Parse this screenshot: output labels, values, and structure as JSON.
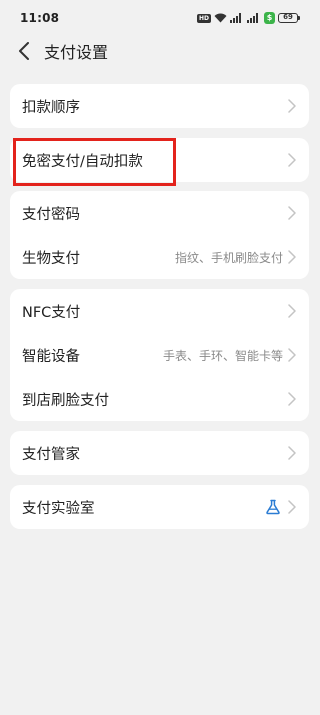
{
  "status_bar": {
    "time": "11:08",
    "hd_label": "HD",
    "battery_level": "69"
  },
  "header": {
    "title": "支付设置"
  },
  "sections": {
    "s1": {
      "r1": {
        "label": "扣款顺序"
      }
    },
    "s2": {
      "r1": {
        "label": "免密支付/自动扣款"
      }
    },
    "s3": {
      "r1": {
        "label": "支付密码"
      },
      "r2": {
        "label": "生物支付",
        "sub": "指纹、手机刷脸支付"
      }
    },
    "s4": {
      "r1": {
        "label": "NFC支付"
      },
      "r2": {
        "label": "智能设备",
        "sub": "手表、手环、智能卡等"
      },
      "r3": {
        "label": "到店刷脸支付"
      }
    },
    "s5": {
      "r1": {
        "label": "支付管家"
      }
    },
    "s6": {
      "r1": {
        "label": "支付实验室",
        "icon": "flask-icon"
      }
    }
  },
  "colors": {
    "highlight": "#e3231c",
    "flask": "#2b7cd3",
    "chevron": "#c4c4c4"
  }
}
